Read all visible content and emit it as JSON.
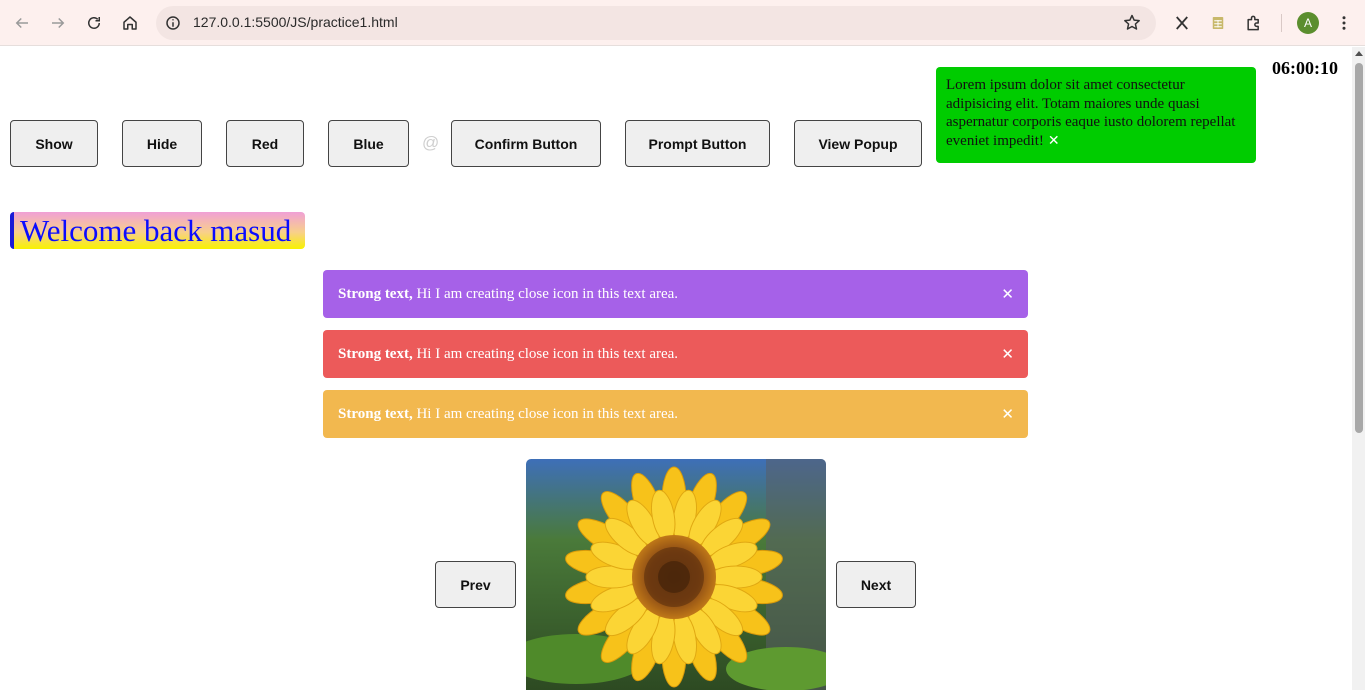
{
  "browser": {
    "url": "127.0.0.1:5500/JS/practice1.html",
    "profile_initial": "A",
    "icons": [
      "back-icon",
      "forward-icon",
      "reload-icon",
      "home-icon",
      "site-info-icon",
      "bookmark-star-icon",
      "x-extension-icon",
      "sheets-extension-icon",
      "extensions-puzzle-icon",
      "menu-kebab-icon"
    ]
  },
  "toolbar": {
    "show_label": "Show",
    "hide_label": "Hide",
    "red_label": "Red",
    "blue_label": "Blue",
    "separator": "@",
    "confirm_label": "Confirm Button",
    "prompt_label": "Prompt Button",
    "view_popup_label": "View Popup"
  },
  "popup": {
    "text": "Lorem ipsum dolor sit amet consectetur adipisicing elit. Totam maiores unde quasi aspernatur corporis eaque iusto dolorem repellat eveniet impedit!",
    "close": "✕",
    "color": "#00cc00"
  },
  "clock": "06:00:10",
  "welcome": {
    "text": "Welcome back masud"
  },
  "alerts": [
    {
      "strong": "Strong text,",
      "text": " Hi I am creating close icon in this text area.",
      "close": "✕",
      "color": "#a661e8"
    },
    {
      "strong": "Strong text,",
      "text": " Hi I am creating close icon in this text area.",
      "close": "✕",
      "color": "#ec5a5a"
    },
    {
      "strong": "Strong text,",
      "text": " Hi I am creating close icon in this text area.",
      "close": "✕",
      "color": "#f2b84f"
    }
  ],
  "slider": {
    "prev_label": "Prev",
    "next_label": "Next",
    "image": "sunflower"
  }
}
